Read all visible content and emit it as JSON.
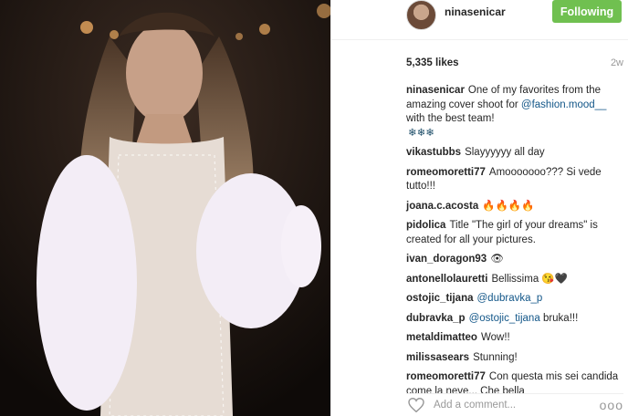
{
  "post": {
    "username": "ninasenicar",
    "follow_label": "Following",
    "likes": "5,335 likes",
    "age": "2w"
  },
  "caption": {
    "user": "ninasenicar",
    "text_before": "One of my favorites from the amazing cover shoot for ",
    "mention": "@fashion.mood__",
    "text_after": " with the best team!",
    "emoji": "❄❄❄"
  },
  "comments": [
    {
      "user": "vikastubbs",
      "text": "Slayyyyyy all day"
    },
    {
      "user": "romeomoretti77",
      "text": "Amooooooo??? Si vede tutto!!!"
    },
    {
      "user": "joana.c.acosta",
      "text": "🔥🔥🔥🔥"
    },
    {
      "user": "pidolica",
      "text": "Title \"The girl of your dreams\" is created for all your pictures."
    },
    {
      "user": "ivan_doragon93",
      "text": "👁"
    },
    {
      "user": "antonellolauretti",
      "text": "Bellissima 😘🖤"
    },
    {
      "user": "ostojic_tijana",
      "mention": "@dubravka_p",
      "text": ""
    },
    {
      "user": "dubravka_p",
      "mention": "@ostojic_tijana",
      "text": "bruka!!!"
    },
    {
      "user": "metaldimatteo",
      "text": "Wow!!"
    },
    {
      "user": "milissasears",
      "text": "Stunning!"
    },
    {
      "user": "romeomoretti77",
      "text": "Con questa mis sei candida come la neve... Che bella"
    }
  ],
  "footer": {
    "placeholder": "Add a comment...",
    "more": "ooo",
    "heart_icon": "heart-outline-icon"
  },
  "colors": {
    "follow_bg": "#70c050",
    "mention": "#125688"
  }
}
